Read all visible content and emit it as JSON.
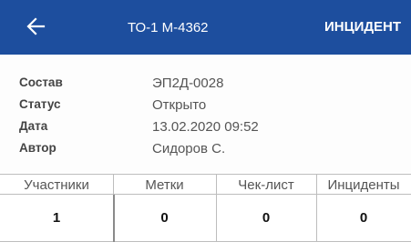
{
  "app_bar": {
    "back_icon": "arrow-left-icon",
    "title": "ТО-1 М-4362",
    "action_label": "ИНЦИДЕНТ",
    "background_color": "#1d4e9e"
  },
  "info": {
    "rows": [
      {
        "label": "Состав",
        "value": "ЭП2Д-0028"
      },
      {
        "label": "Статус",
        "value": "Открыто"
      },
      {
        "label": "Дата",
        "value": "13.02.2020 09:52"
      },
      {
        "label": "Автор",
        "value": "Сидоров С."
      }
    ]
  },
  "tabs": [
    {
      "label": "Участники",
      "count": "1"
    },
    {
      "label": "Метки",
      "count": "0"
    },
    {
      "label": "Чек-лист",
      "count": "0"
    },
    {
      "label": "Инциденты",
      "count": "0"
    }
  ]
}
